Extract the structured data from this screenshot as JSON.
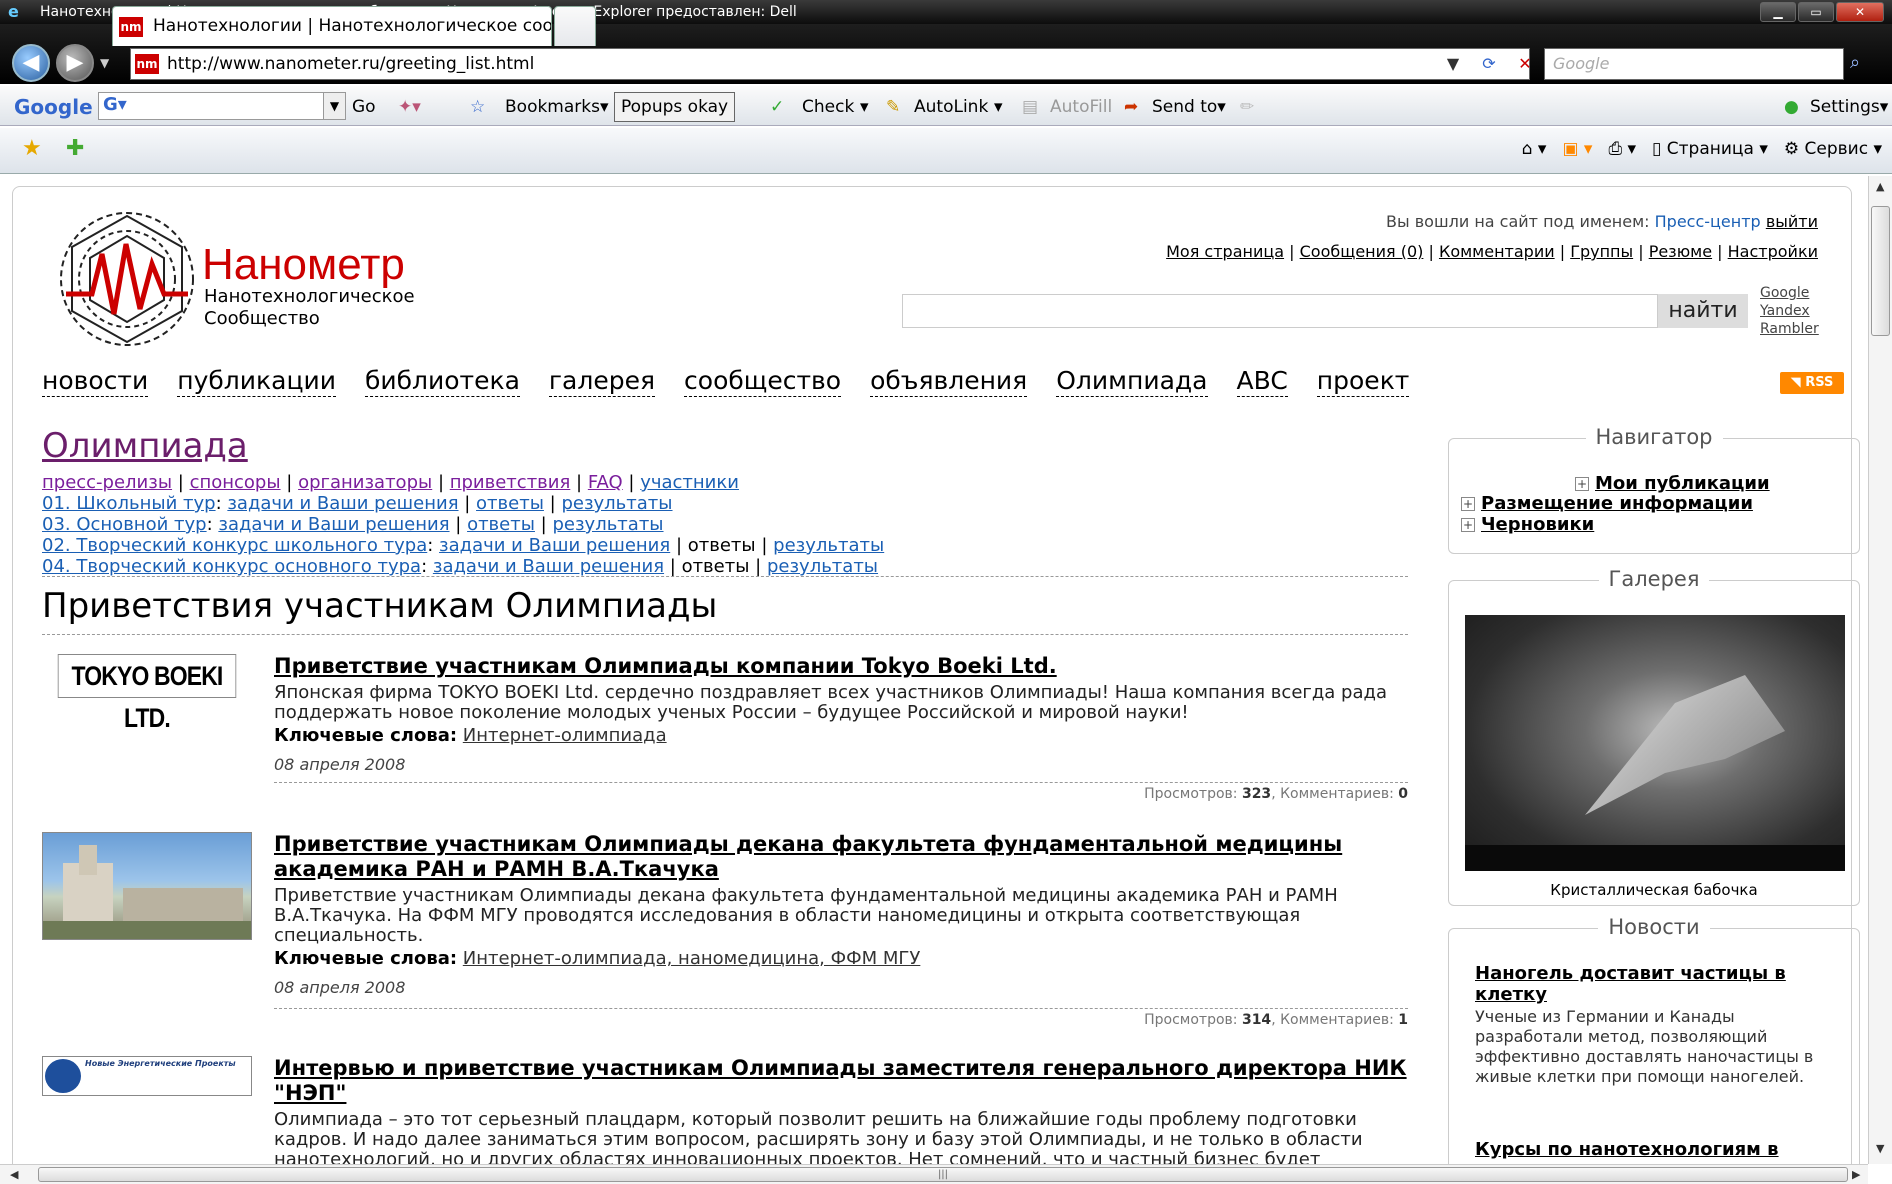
{
  "browser": {
    "window_title": "Нанотехнологии | Нанотехнологическое сообщество - Нанометр - Internet Explorer предоставлен: Dell",
    "url": "http://www.nanometer.ru/greeting_list.html",
    "favicon_text": "nm",
    "google_placeholder": "Google",
    "tab_title": "Нанотехнологии | Нанотехнологическое сооб...",
    "toolbar": {
      "google_logo": "Google",
      "go": "Go",
      "bookmarks": "Bookmarks▾",
      "popups": "Popups okay",
      "check": "Check",
      "autolink": "AutoLink",
      "autofill": "AutoFill",
      "sendto": "Send to▾",
      "settings": "Settings▾"
    },
    "cmd": {
      "page": "Страница",
      "service": "Сервис"
    }
  },
  "site": {
    "brand": "Нанометр",
    "brand_sub1": "Нанотехнологическое",
    "brand_sub2": "Сообщество",
    "user": {
      "logged_prefix": "Вы вошли на сайт под именем:",
      "user_name": "Пресс-центр",
      "logout": "выйти"
    },
    "usermenu": [
      "Моя страница",
      "Сообщения (0)",
      "Комментарии",
      "Группы",
      "Резюме",
      "Настройки"
    ],
    "search_button": "найти",
    "engines": [
      "Google",
      "Yandex",
      "Rambler"
    ],
    "nav": [
      "новости",
      "публикации",
      "библиотека",
      "галерея",
      "сообщество",
      "объявления",
      "Олимпиада",
      "ABC",
      "проект"
    ],
    "rss": "RSS"
  },
  "page": {
    "title": "Олимпиада",
    "links1": [
      "пресс-релизы",
      "спонсоры",
      "организаторы",
      "приветствия",
      "FAQ",
      "участники"
    ],
    "rows": [
      {
        "stage": "01. Школьный тур",
        "tasks": "задачи и Ваши решения",
        "answers": "ответы",
        "results": "результаты"
      },
      {
        "stage": "03. Основной тур",
        "tasks": "задачи и Ваши решения",
        "answers": "ответы",
        "results": "результаты"
      },
      {
        "stage": "02. Творческий конкурс школьного тура",
        "tasks": "задачи и Ваши решения",
        "answers": "ответы",
        "results": "результаты"
      },
      {
        "stage": "04. Творческий конкурс основного тура",
        "tasks": "задачи и Ваши решения",
        "answers": "ответы",
        "results": "результаты"
      }
    ],
    "heading": "Приветствия участникам Олимпиады",
    "kw_label": "Ключевые слова:",
    "views_label": "Просмотров:",
    "comments_label": "Комментариев:",
    "items": [
      {
        "thumb_text": "TOKYO BOEKI LTD.",
        "title": "Приветствие участникам Олимпиады компании Tokyo Boeki Ltd.",
        "desc": "Японская фирма TOKYO BOEKI Ltd. сердечно поздравляет всех участников Олимпиады! Наша компания всегда рада поддержать новое поколение молодых ученых России – будущее Российской и мировой науки!",
        "keywords": "Интернет-олимпиада",
        "date": "08 апреля 2008",
        "views": "323",
        "comments": "0"
      },
      {
        "title": "Приветствие участникам Олимпиады декана факультета фундаментальной медицины академика РАН и РАМН В.А.Ткачука",
        "desc": "Приветствие участникам Олимпиады декана факультета фундаментальной медицины академика РАН и РАМН В.А.Ткачука. На ФФМ МГУ проводятся исследования в области наномедицины и открыта соответствующая специальность.",
        "keywords": "Интернет-олимпиада, наномедицина, ФФМ МГУ",
        "date": "08 апреля 2008",
        "views": "314",
        "comments": "1"
      },
      {
        "thumb_text": "Новые Энергетические Проекты",
        "title": "Интервью и приветствие участникам Олимпиады заместителя генерального директора НИК \"НЭП\"",
        "desc": "Олимпиада – это тот серьезный плацдарм, который позволит решить на ближайшие годы проблему подготовки кадров. И надо далее заниматься этим вопросом, расширять зону и базу этой Олимпиады, и не только в области нанотехнологий, но и других областях инновационных проектов. Нет сомнений, что и частный бизнес будет"
      }
    ]
  },
  "sidebar": {
    "navigator_title": "Навигатор",
    "nav_items": [
      "Мои публикации",
      "Размещение информации",
      "Черновики"
    ],
    "gallery_title": "Галерея",
    "gallery_caption": "Кристаллическая бабочка",
    "news_title": "Новости",
    "news": [
      {
        "title": "Наногель доставит частицы в клетку",
        "desc": "Ученые из Германии и Канады разработали метод, позволяющий эффективно доставлять наночастицы в живые клетки при помощи наногелей."
      },
      {
        "title": "Курсы по нанотехнологиям в"
      }
    ]
  }
}
